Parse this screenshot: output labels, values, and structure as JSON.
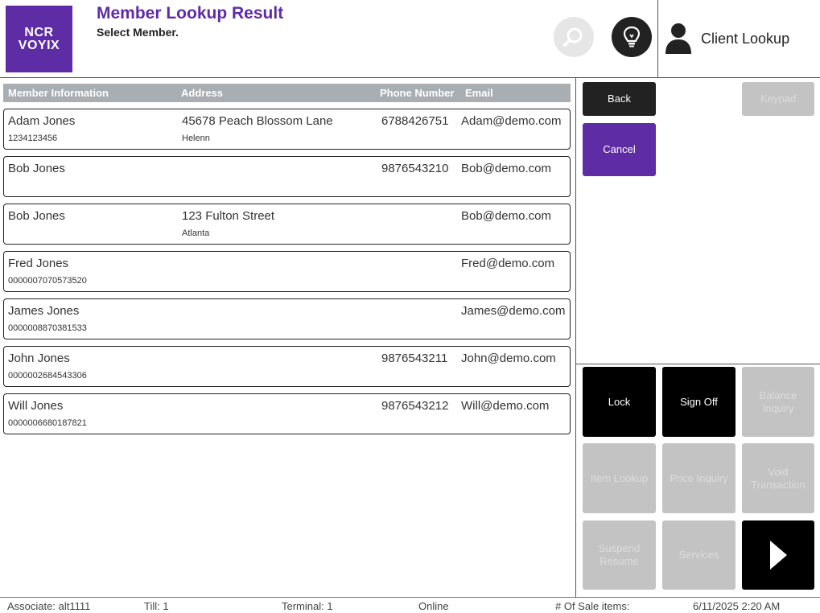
{
  "header": {
    "logo_line1": "NCR",
    "logo_line2": "VOYIX",
    "title": "Member Lookup Result",
    "subtitle": "Select Member.",
    "client_lookup_label": "Client Lookup"
  },
  "table": {
    "columns": [
      "Member Information",
      "Address",
      "Phone Number",
      "Email"
    ],
    "rows": [
      {
        "name": "Adam Jones",
        "id": "1234123456",
        "address": "45678 Peach Blossom Lane",
        "city": "Helenn",
        "phone": "6788426751",
        "email": "Adam@demo.com"
      },
      {
        "name": "Bob Jones",
        "id": "",
        "address": "",
        "city": "",
        "phone": "9876543210",
        "email": "Bob@demo.com"
      },
      {
        "name": "Bob Jones",
        "id": "",
        "address": "123 Fulton Street",
        "city": "Atlanta",
        "phone": "",
        "email": "Bob@demo.com"
      },
      {
        "name": "Fred Jones",
        "id": "0000007070573520",
        "address": "",
        "city": "",
        "phone": "",
        "email": "Fred@demo.com"
      },
      {
        "name": "James Jones",
        "id": "0000008870381533",
        "address": "",
        "city": "",
        "phone": "",
        "email": "James@demo.com"
      },
      {
        "name": "John Jones",
        "id": "0000002684543306",
        "address": "",
        "city": "",
        "phone": "9876543211",
        "email": "John@demo.com"
      },
      {
        "name": "Will Jones",
        "id": "0000006680187821",
        "address": "",
        "city": "",
        "phone": "9876543212",
        "email": "Will@demo.com"
      }
    ]
  },
  "buttons": {
    "back": "Back",
    "cancel": "Cancel",
    "keypad": "Keypad",
    "lock": "Lock",
    "sign_off": "Sign Off",
    "balance_inquiry": "Balance Inquiry",
    "item_lookup": "Item Lookup",
    "price_inquiry": "Price Inquiry",
    "void_transaction": "Void Transaction",
    "suspend_resume": "Suspend Resume",
    "services": "Services"
  },
  "status": {
    "associate": "Associate: alt1111",
    "till": "Till: 1",
    "terminal": "Terminal: 1",
    "online": "Online",
    "sale_items": "# Of Sale items:",
    "datetime": "6/11/2025 2:20 AM"
  },
  "icons": {
    "search": "search-icon",
    "bulb": "lightbulb-icon",
    "user": "user-icon",
    "next": "play-arrow-icon"
  },
  "colors": {
    "brand": "#5e2ca5",
    "header_gray": "#a9aeb3",
    "disabled": "#c3c3c3"
  }
}
